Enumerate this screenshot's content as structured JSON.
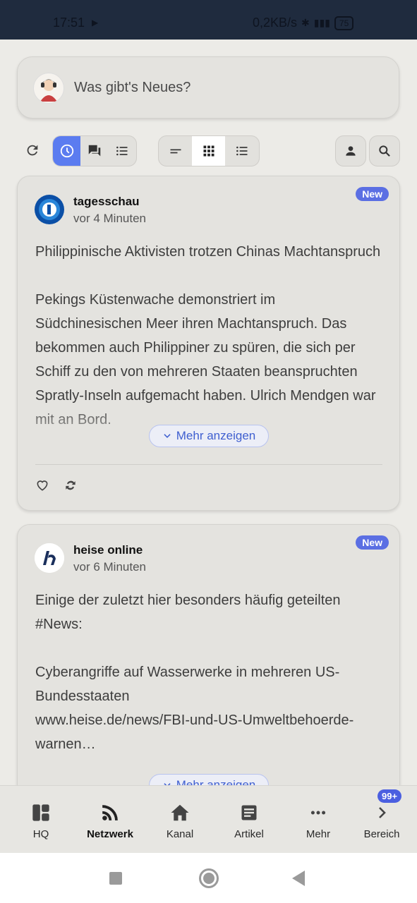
{
  "status_bar": {
    "time": "17:51",
    "network_speed": "0,2KB/s",
    "battery": "75"
  },
  "composer": {
    "placeholder": "Was gibt's Neues?"
  },
  "toolbar": {
    "icons": [
      "refresh-icon",
      "clock-icon",
      "chat-icon",
      "list-icon",
      "short-lines-icon",
      "grid-icon",
      "list-icon",
      "person-icon",
      "search-icon"
    ]
  },
  "posts": [
    {
      "author": "tagesschau",
      "time": "vor 4 Minuten",
      "badge": "New",
      "title": "Philippinische Aktivisten trotzen Chinas Machtanspruch",
      "text": "Pekings Küstenwache demonstriert im Südchinesischen Meer ihren Machtanspruch. Das bekommen auch Philippiner zu spüren, die sich per Schiff zu den von mehreren Staaten beanspruchten Spratly-Inseln aufgemacht haben. Ulrich Mendgen war mit an Bord.",
      "more_label": "Mehr anzeigen"
    },
    {
      "author": "heise online",
      "time": "vor 6 Minuten",
      "badge": "New",
      "title": "Einige der zuletzt hier besonders häufig geteilten #News:",
      "text": "Cyberangriffe auf Wasserwerke in mehreren US-Bundesstaaten",
      "link": "www.heise.de/news/FBI-und-US-Umweltbehoerde-warnen…",
      "more_label": "Mehr anzeigen"
    }
  ],
  "bottom_nav": {
    "items": [
      {
        "label": "HQ"
      },
      {
        "label": "Netzwerk"
      },
      {
        "label": "Kanal"
      },
      {
        "label": "Artikel"
      },
      {
        "label": "Mehr"
      },
      {
        "label": "Bereich"
      }
    ],
    "badge": "99+"
  },
  "colors": {
    "accent": "#5b7cf0",
    "badge": "#5b6fe3",
    "status_bar": "#1f2b3e"
  }
}
